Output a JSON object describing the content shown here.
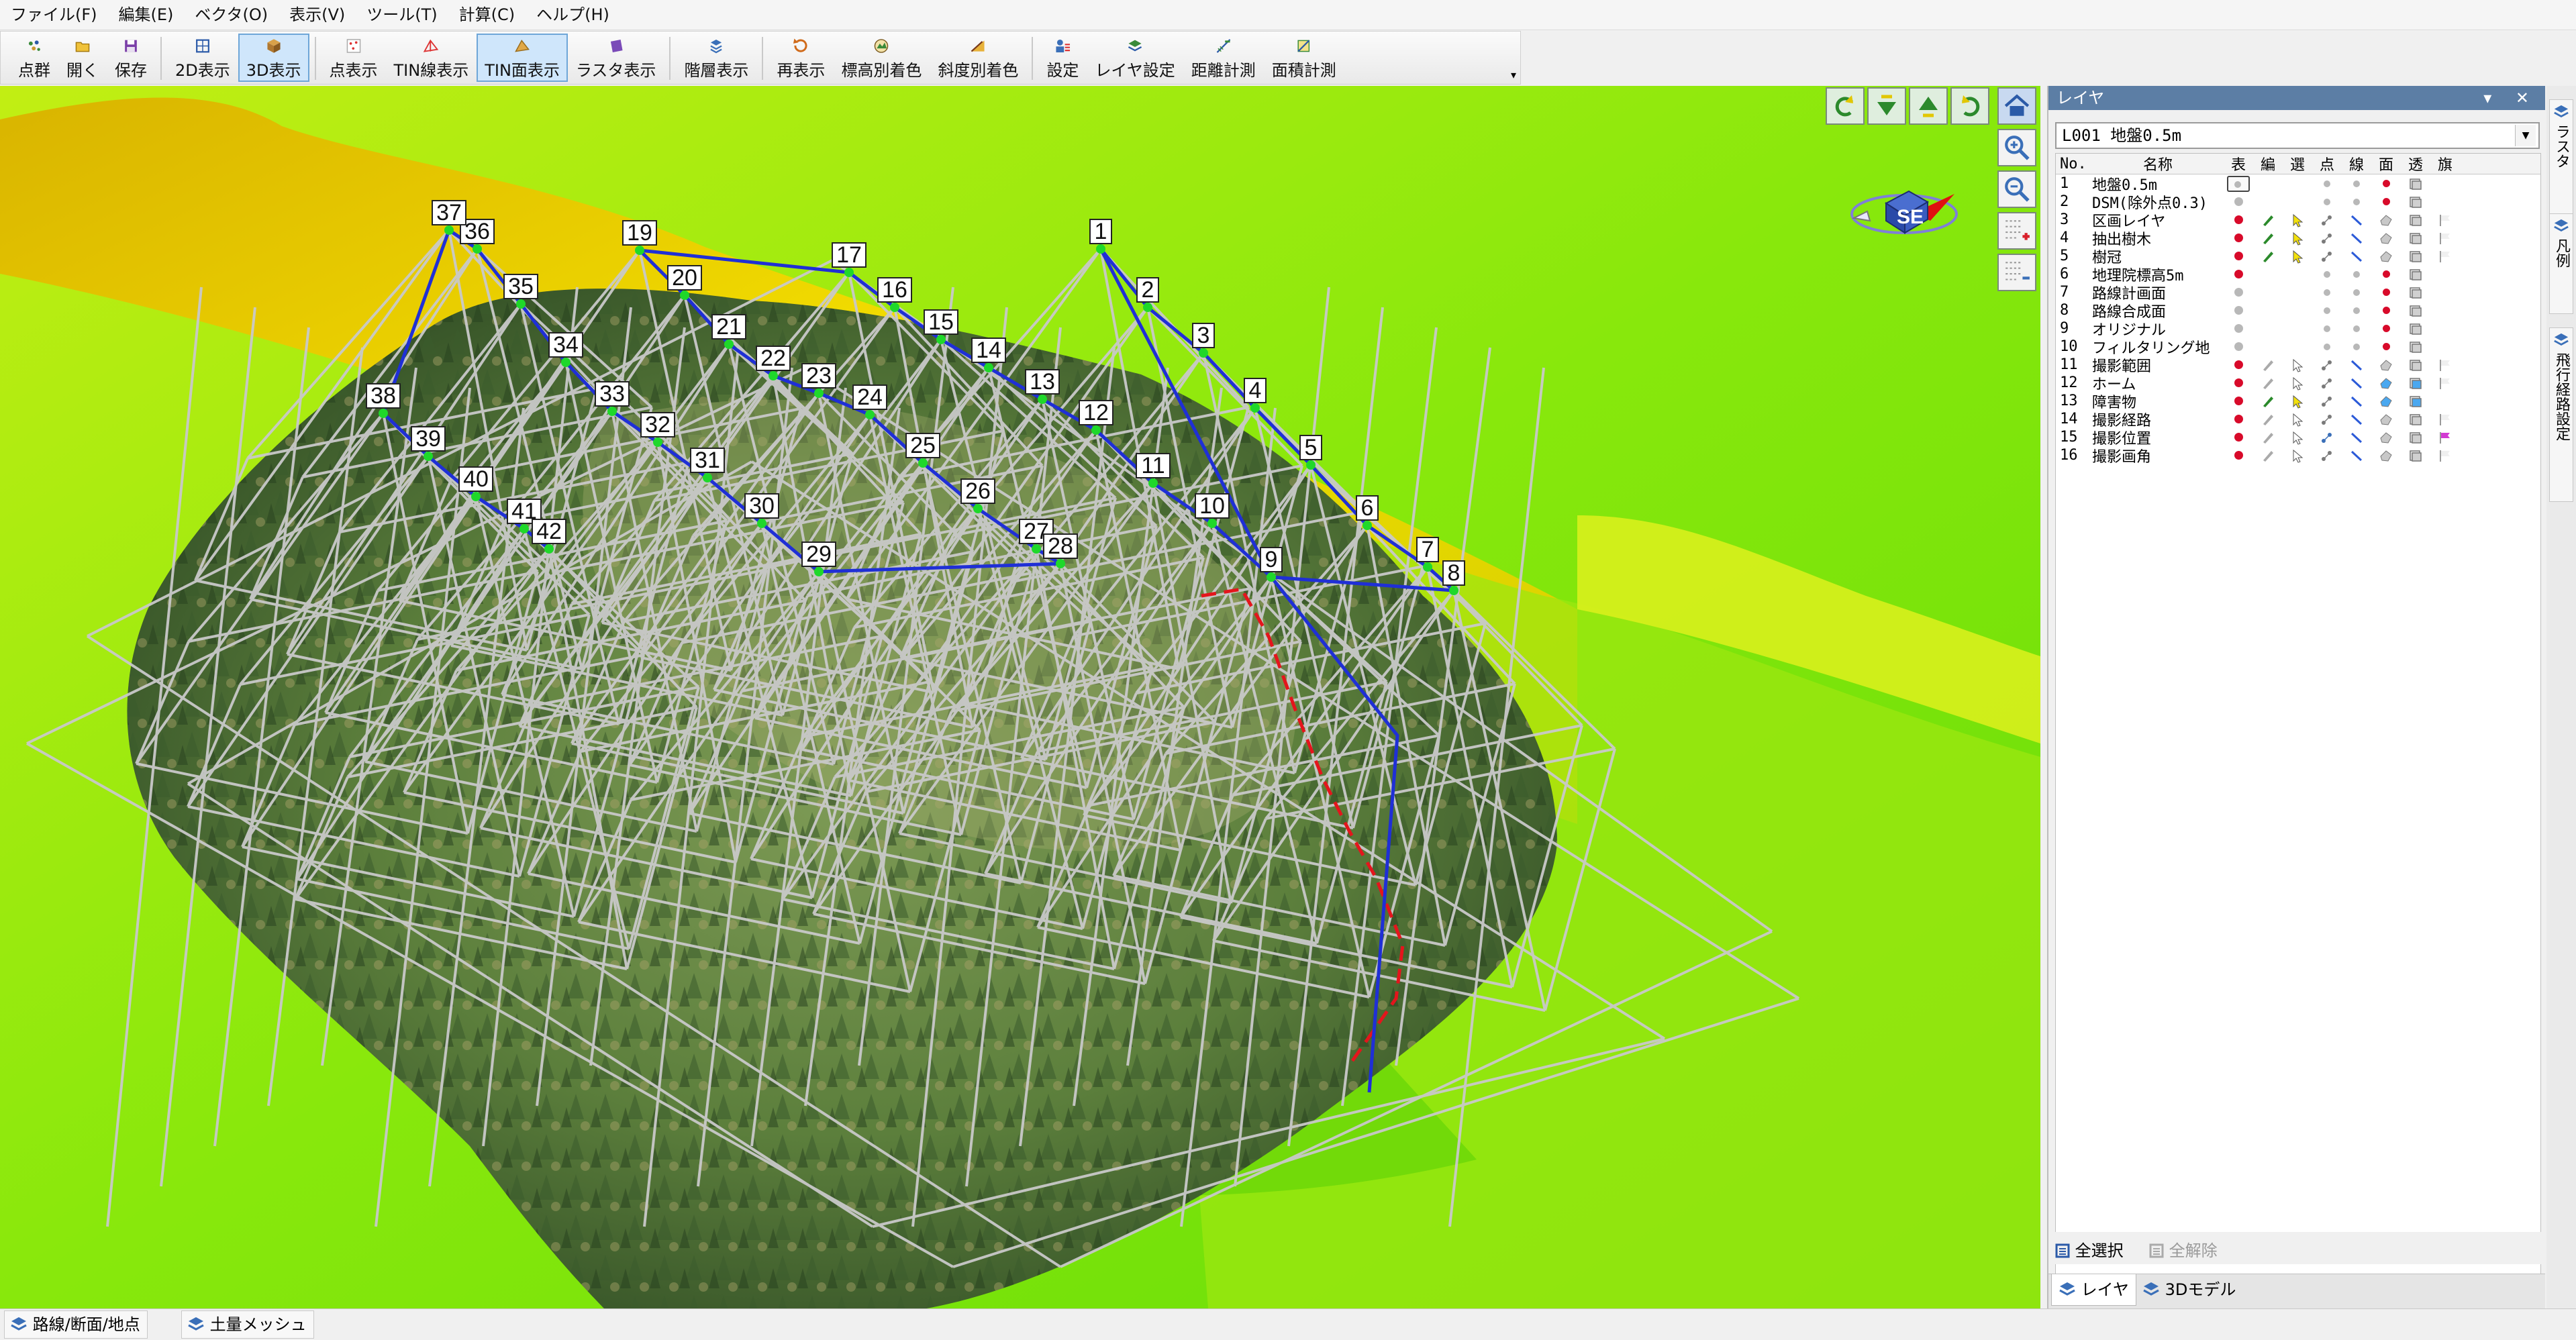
{
  "menu": [
    "ファイル(F)",
    "編集(E)",
    "ベクタ(O)",
    "表示(V)",
    "ツール(T)",
    "計算(C)",
    "ヘルプ(H)"
  ],
  "toolbar": [
    {
      "label": "点群",
      "icon": "point-cloud-icon",
      "active": false
    },
    {
      "label": "開く",
      "icon": "open-icon",
      "active": false
    },
    {
      "label": "保存",
      "icon": "save-icon",
      "active": false
    },
    {
      "sep": true
    },
    {
      "label": "2D表示",
      "icon": "2d-view-icon",
      "active": false
    },
    {
      "label": "3D表示",
      "icon": "3d-view-icon",
      "active": true
    },
    {
      "sep": true
    },
    {
      "label": "点表示",
      "icon": "point-display-icon",
      "active": false
    },
    {
      "label": "TIN線表示",
      "icon": "tin-line-icon",
      "active": false
    },
    {
      "label": "TIN面表示",
      "icon": "tin-face-icon",
      "active": true
    },
    {
      "label": "ラスタ表示",
      "icon": "raster-icon",
      "active": false
    },
    {
      "sep": true
    },
    {
      "label": "階層表示",
      "icon": "hierarchy-icon",
      "active": false
    },
    {
      "sep": true
    },
    {
      "label": "再表示",
      "icon": "redraw-icon",
      "active": false
    },
    {
      "label": "標高別着色",
      "icon": "elevation-color-icon",
      "active": false
    },
    {
      "label": "斜度別着色",
      "icon": "slope-color-icon",
      "active": false
    },
    {
      "sep": true
    },
    {
      "label": "設定",
      "icon": "settings-icon",
      "active": false
    },
    {
      "label": "レイヤ設定",
      "icon": "layer-settings-icon",
      "active": false
    },
    {
      "label": "距離計測",
      "icon": "distance-icon",
      "active": false
    },
    {
      "label": "面積計測",
      "icon": "area-icon",
      "active": false
    }
  ],
  "viewport": {
    "compass_label": "SE",
    "waypoints": [
      {
        "n": "1"
      },
      {
        "n": "2"
      },
      {
        "n": "3"
      },
      {
        "n": "4"
      },
      {
        "n": "5"
      },
      {
        "n": "6"
      },
      {
        "n": "7"
      },
      {
        "n": "8"
      },
      {
        "n": "9"
      },
      {
        "n": "10"
      },
      {
        "n": "11"
      },
      {
        "n": "12"
      },
      {
        "n": "13"
      },
      {
        "n": "14"
      },
      {
        "n": "15"
      },
      {
        "n": "16"
      },
      {
        "n": "17"
      },
      {
        "n": "19"
      },
      {
        "n": "20"
      },
      {
        "n": "21"
      },
      {
        "n": "22"
      },
      {
        "n": "23"
      },
      {
        "n": "24"
      },
      {
        "n": "25"
      },
      {
        "n": "26"
      },
      {
        "n": "27"
      },
      {
        "n": "28"
      },
      {
        "n": "29"
      },
      {
        "n": "30"
      },
      {
        "n": "31"
      },
      {
        "n": "32"
      },
      {
        "n": "33"
      },
      {
        "n": "34"
      },
      {
        "n": "35"
      },
      {
        "n": "36"
      },
      {
        "n": "37"
      },
      {
        "n": "38"
      },
      {
        "n": "39"
      },
      {
        "n": "40"
      },
      {
        "n": "41"
      },
      {
        "n": "42"
      }
    ]
  },
  "panel": {
    "title": "レイヤ",
    "title_buttons": "▾ ✕",
    "current_layer": "L001 地盤0.5m",
    "headers": {
      "no": "No.",
      "name": "名称",
      "cols": [
        "表",
        "編",
        "選",
        "点",
        "線",
        "面",
        "透",
        "旗"
      ]
    },
    "layers": [
      {
        "no": "1",
        "name": "地盤0.5m",
        "special": "box"
      },
      {
        "no": "2",
        "name": "DSM(除外点0.3)",
        "hidden": true,
        "noedit": true
      },
      {
        "no": "3",
        "name": "区画レイヤ",
        "edit": "green",
        "flag": true
      },
      {
        "no": "4",
        "name": "抽出樹木",
        "edit": "green",
        "flag": true
      },
      {
        "no": "5",
        "name": "樹冠",
        "edit": "green",
        "flag": true
      },
      {
        "no": "6",
        "name": "地理院標高5m",
        "noedit": true
      },
      {
        "no": "7",
        "name": "路線計画面",
        "hidden": true,
        "noedit": true
      },
      {
        "no": "8",
        "name": "路線合成面",
        "hidden": true,
        "noedit": true
      },
      {
        "no": "9",
        "name": "オリジナル",
        "hidden": true,
        "noedit": true
      },
      {
        "no": "10",
        "name": "フィルタリング地",
        "hidden": true,
        "noedit": true
      },
      {
        "no": "11",
        "name": "撮影範囲",
        "edit": "gray",
        "flag": true
      },
      {
        "no": "12",
        "name": "ホーム",
        "edit": "gray",
        "flag": true,
        "face": "blue"
      },
      {
        "no": "13",
        "name": "障害物",
        "edit": "green",
        "flag": false,
        "face": "blue"
      },
      {
        "no": "14",
        "name": "撮影経路",
        "edit": "gray",
        "flag": true
      },
      {
        "no": "15",
        "name": "撮影位置",
        "edit": "gray",
        "flag": true,
        "flagcolor": "magenta"
      },
      {
        "no": "16",
        "name": "撮影画角",
        "edit": "gray",
        "flag": true
      }
    ],
    "select_all": "全選択",
    "deselect_all": "全解除",
    "tabs": [
      "レイヤ",
      "3Dモデル"
    ]
  },
  "side_tabs": [
    "ラスタ",
    "凡例",
    "飛行経路設定"
  ],
  "bottom_tabs": [
    "路線/断面/地点",
    "土量メッシュ"
  ],
  "colors": {
    "route": "#1f2fd6",
    "red_line": "#e4151c",
    "tin_line": "#c9c9c9",
    "waypoint_marker": "#1fd82a",
    "terrain_yellow": "#e7c400",
    "terrain_green": "#7fe60d",
    "panel_title": "#5c7ea5"
  }
}
